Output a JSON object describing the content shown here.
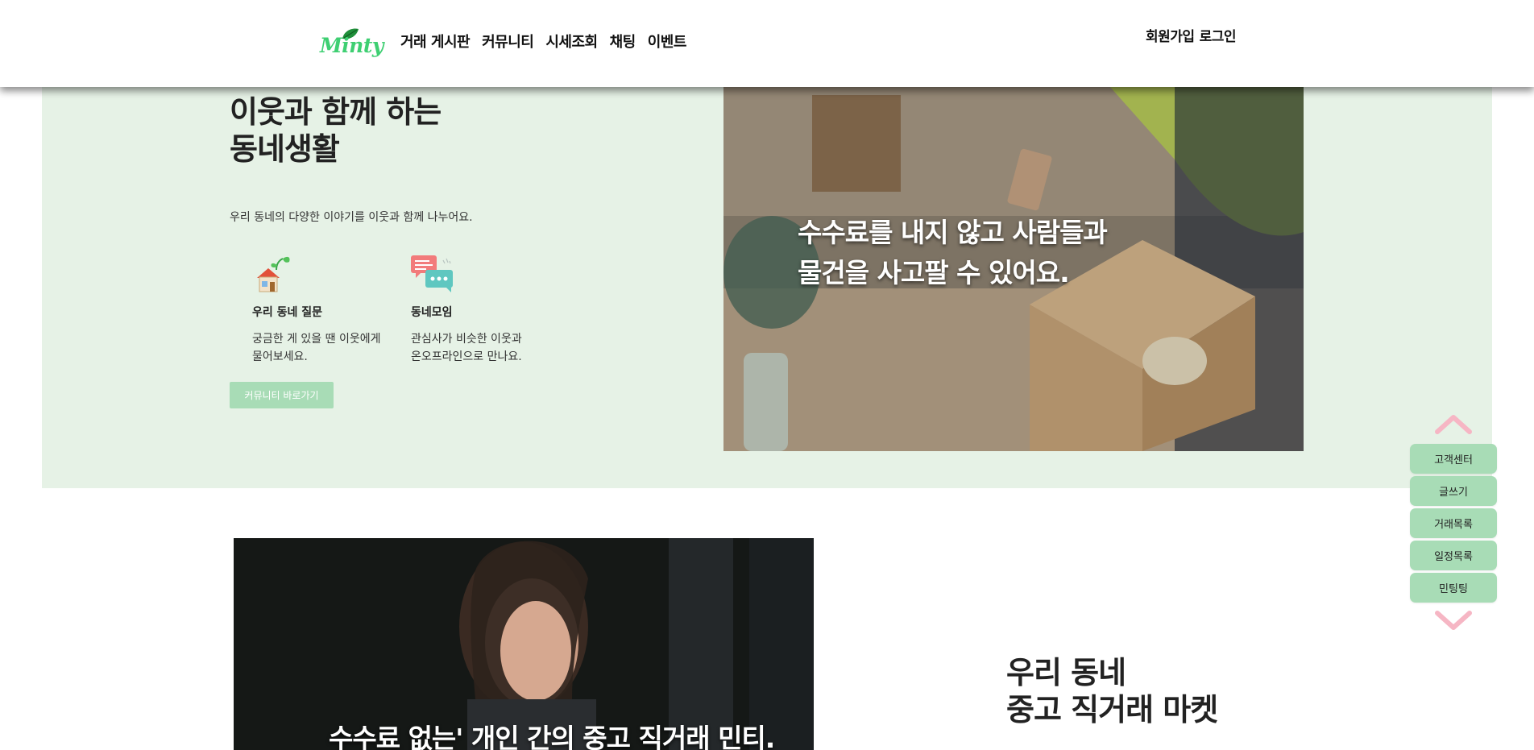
{
  "header": {
    "logo_text": "Minty",
    "nav": [
      "거래 게시판",
      "커뮤니티",
      "시세조회",
      "채팅",
      "이벤트"
    ],
    "auth": {
      "signup": "회원가입",
      "login": "로그인"
    }
  },
  "hero": {
    "title_line1": "이웃과 함께 하는",
    "title_line2": "동네생활",
    "description": "우리 동네의 다양한 이야기를 이웃과 함께 나누어요.",
    "features": [
      {
        "icon": "house-sprout-icon",
        "title": "우리 동네 질문",
        "desc_line1": "궁금한 게 있을 땐 이웃에게",
        "desc_line2": "물어보세요."
      },
      {
        "icon": "chat-bubbles-icon",
        "title": "동네모임",
        "desc_line1": "관심사가 비슷한 이웃과",
        "desc_line2": "온오프라인으로 만나요."
      }
    ],
    "cta_label": "커뮤니티 바로가기",
    "image_text_line1": "수수료를 내지 않고 사람들과",
    "image_text_line2": "물건을 사고팔 수 있어요."
  },
  "section2": {
    "image_text": "수수료 없는' 개인 간의 중고 직거래 민티.",
    "title_line1": "우리 동네",
    "title_line2": "중고 직거래 마켓"
  },
  "quick_menu": {
    "items": [
      "고객센터",
      "글쓰기",
      "거래목록",
      "일정목록",
      "민팅팅"
    ],
    "up_icon": "chevron-up-icon",
    "down_icon": "chevron-down-icon"
  },
  "colors": {
    "brand": "#3ecf72",
    "hero_bg": "#e6f2e6",
    "button_green": "#a8dcb6",
    "chevron_pink": "#f6b6c4"
  }
}
